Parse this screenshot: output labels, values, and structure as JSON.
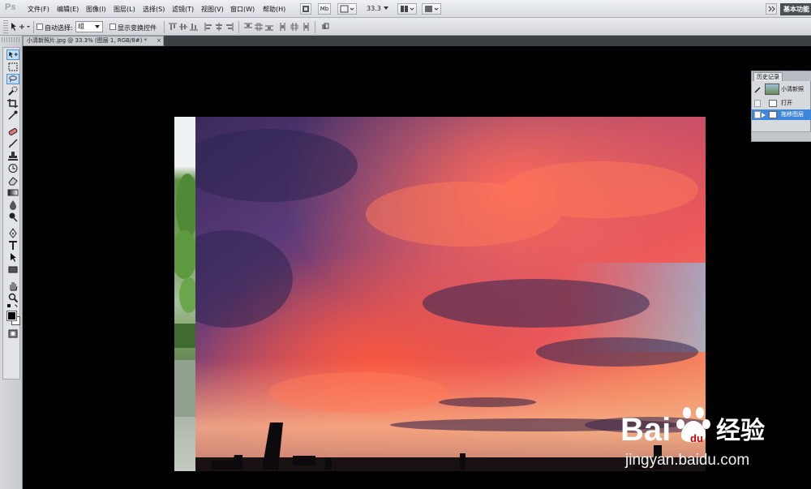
{
  "app": {
    "logo": "Ps"
  },
  "menu": {
    "items": [
      "文件(F)",
      "编辑(E)",
      "图像(I)",
      "图层(L)",
      "选择(S)",
      "滤镜(T)",
      "视图(V)",
      "窗口(W)",
      "帮助(H)"
    ],
    "mb_label": "Mb",
    "zoom": "33.3",
    "workspace": "基本功能"
  },
  "options": {
    "auto_select_label": "自动选择:",
    "auto_select_value": "组",
    "show_transform_label": "显示变换控件"
  },
  "document": {
    "tab_title": "小清新照片.jpg @ 33.3% (图层 1, RGB/8#) *",
    "close_label": "×"
  },
  "history": {
    "tab_label": "历史记录",
    "snapshot_label": "小清新照",
    "steps": [
      "打开",
      "拖移图层"
    ]
  },
  "watermark": {
    "brand": "Bai 经验",
    "url": "jingyan.baidu.com"
  },
  "colors": {
    "foreground": "#000000",
    "background": "#ffffff",
    "selection": "#3d86d9",
    "workspace_button": "#4a4f55"
  }
}
